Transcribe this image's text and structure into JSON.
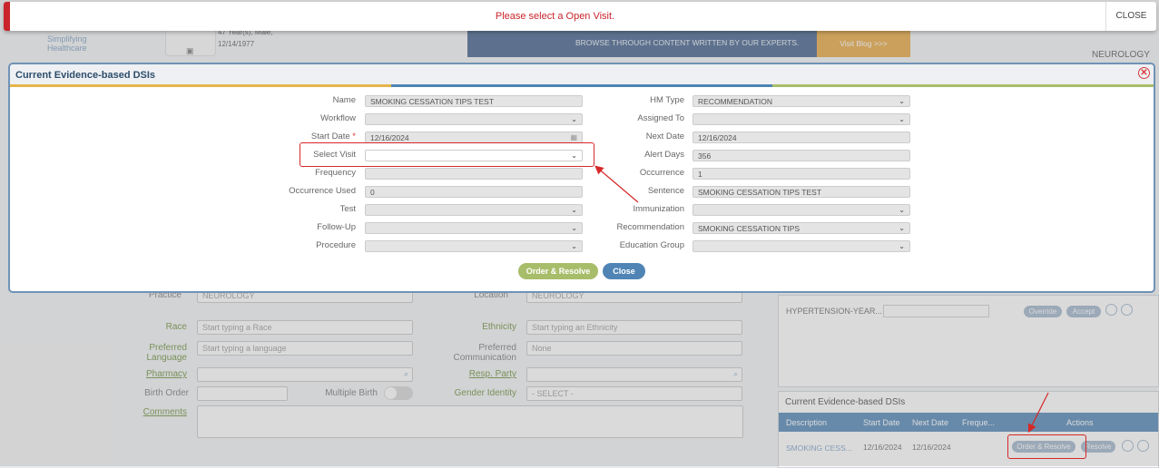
{
  "toast": {
    "message": "Please select a Open Visit.",
    "close_label": "CLOSE"
  },
  "background": {
    "patient_line1": "47 Year(s), Male,",
    "patient_line2": "12/14/1977",
    "logo_tagline": "Simplifying Healthcare",
    "banner_text": "BROWSE THROUGH CONTENT WRITTEN BY OUR EXPERTS.",
    "banner_button": "Visit Blog >>>",
    "specialty": "NEUROLOGY",
    "form": {
      "practice_label": "Practice",
      "practice_value": "NEUROLOGY",
      "location_label": "Location",
      "location_value": "NEUROLOGY",
      "race_label": "Race",
      "race_placeholder": "Start typing a Race",
      "ethnicity_label": "Ethnicity",
      "ethnicity_placeholder": "Start typing an Ethnicity",
      "pref_lang_label1": "Preferred",
      "pref_lang_label2": "Language",
      "pref_lang_placeholder": "Start typing a language",
      "pref_comm_label1": "Preferred",
      "pref_comm_label2": "Communication",
      "pref_comm_value": "None",
      "pharmacy_label": "Pharmacy",
      "resp_party_label": "Resp. Party",
      "birth_order_label": "Birth Order",
      "multiple_birth_label": "Multiple Birth",
      "gender_identity_label": "Gender Identity",
      "gender_identity_value": "- SELECT -",
      "comments_label": "Comments"
    },
    "hm_row": {
      "label": "HYPERTENSION-YEAR...",
      "override": "Override",
      "accept": "Accept"
    },
    "dsi_panel": {
      "title": "Current Evidence-based DSIs",
      "columns": [
        "Description",
        "Start Date",
        "Next Date",
        "Freque...",
        "Actions"
      ],
      "row": {
        "description": "SMOKING CESS...",
        "start": "12/16/2024",
        "next": "12/16/2024",
        "order_resolve": "Order & Resolve",
        "resolve": "Resolve"
      }
    }
  },
  "modal": {
    "title": "Current Evidence-based DSIs",
    "left_fields": [
      {
        "label": "Name",
        "value": "SMOKING CESSATION TIPS TEST",
        "select": false
      },
      {
        "label": "Workflow",
        "value": "",
        "select": true
      },
      {
        "label": "Start Date",
        "value": "12/16/2024",
        "select": false
      },
      {
        "label": "Select Visit",
        "value": "",
        "select": true
      },
      {
        "label": "Frequency",
        "value": "",
        "select": false
      },
      {
        "label": "Occurrence Used",
        "value": "0",
        "select": false
      },
      {
        "label": "Test",
        "value": "",
        "select": true
      },
      {
        "label": "Follow-Up",
        "value": "",
        "select": true
      },
      {
        "label": "Procedure",
        "value": "",
        "select": true
      }
    ],
    "right_fields": [
      {
        "label": "HM Type",
        "value": "RECOMMENDATION",
        "select": true
      },
      {
        "label": "Assigned To",
        "value": "",
        "select": true
      },
      {
        "label": "Next Date",
        "value": "12/16/2024",
        "select": false
      },
      {
        "label": "Alert Days",
        "value": "356",
        "select": false
      },
      {
        "label": "Occurrence",
        "value": "1",
        "select": false
      },
      {
        "label": "Sentence",
        "value": "SMOKING CESSATION TIPS TEST",
        "select": false
      },
      {
        "label": "Immunization",
        "value": "",
        "select": true
      },
      {
        "label": "Recommendation",
        "value": "SMOKING CESSATION TIPS",
        "select": true
      },
      {
        "label": "Education Group",
        "value": "",
        "select": true
      }
    ],
    "required_mark": "*",
    "order_resolve_label": "Order & Resolve",
    "close_label": "Close"
  },
  "colors": {
    "accent_red": "#c9242b",
    "primary_blue": "#4f84b5",
    "order_green": "#a8bd6a"
  }
}
